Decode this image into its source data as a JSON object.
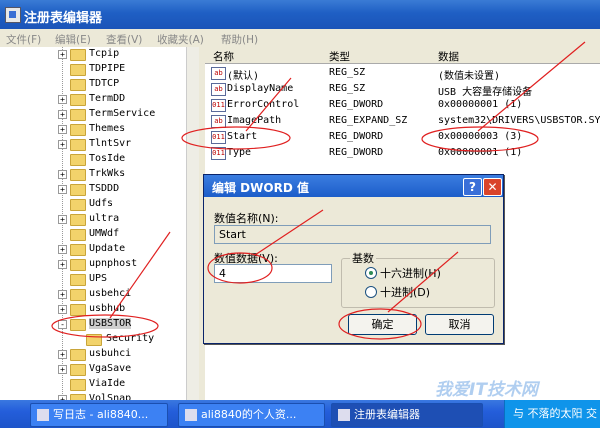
{
  "window": {
    "title": "注册表编辑器"
  },
  "menu": [
    "文件(F)",
    "编辑(E)",
    "查看(V)",
    "收藏夹(A)",
    "帮助(H)"
  ],
  "tree": {
    "items": [
      {
        "label": "Tcpip",
        "expander": "+"
      },
      {
        "label": "TDPIPE",
        "expander": ""
      },
      {
        "label": "TDTCP",
        "expander": ""
      },
      {
        "label": "TermDD",
        "expander": "+"
      },
      {
        "label": "TermService",
        "expander": "+"
      },
      {
        "label": "Themes",
        "expander": "+"
      },
      {
        "label": "TlntSvr",
        "expander": "+"
      },
      {
        "label": "TosIde",
        "expander": ""
      },
      {
        "label": "TrkWks",
        "expander": "+"
      },
      {
        "label": "TSDDD",
        "expander": "+"
      },
      {
        "label": "Udfs",
        "expander": ""
      },
      {
        "label": "ultra",
        "expander": "+"
      },
      {
        "label": "UMWdf",
        "expander": ""
      },
      {
        "label": "Update",
        "expander": "+"
      },
      {
        "label": "upnphost",
        "expander": "+"
      },
      {
        "label": "UPS",
        "expander": ""
      },
      {
        "label": "usbehci",
        "expander": "+"
      },
      {
        "label": "usbhub",
        "expander": "+"
      },
      {
        "label": "USBSTOR",
        "expander": "-"
      },
      {
        "label": "Security",
        "expander": ""
      },
      {
        "label": "usbuhci",
        "expander": "+"
      },
      {
        "label": "VgaSave",
        "expander": "+"
      },
      {
        "label": "ViaIde",
        "expander": ""
      },
      {
        "label": "VolSnap",
        "expander": "+"
      }
    ]
  },
  "list": {
    "headers": [
      "名称",
      "类型",
      "数据"
    ],
    "rows": [
      {
        "icon": "ab",
        "name": "(默认)",
        "type": "REG_SZ",
        "data": "(数值未设置)"
      },
      {
        "icon": "ab",
        "name": "DisplayName",
        "type": "REG_SZ",
        "data": "USB 大容量存储设备"
      },
      {
        "icon": "011",
        "name": "ErrorControl",
        "type": "REG_DWORD",
        "data": "0x00000001 (1)"
      },
      {
        "icon": "ab",
        "name": "ImagePath",
        "type": "REG_EXPAND_SZ",
        "data": "system32\\DRIVERS\\USBSTOR.SYS"
      },
      {
        "icon": "011",
        "name": "Start",
        "type": "REG_DWORD",
        "data": "0x00000003 (3)"
      },
      {
        "icon": "011",
        "name": "Type",
        "type": "REG_DWORD",
        "data": "0x00000001 (1)"
      }
    ]
  },
  "dialog": {
    "title": "编辑 DWORD 值",
    "help_label": "?",
    "close_label": "✕",
    "name_label": "数值名称(N):",
    "name_value": "Start",
    "data_label": "数值数据(V):",
    "data_value": "4",
    "base_legend": "基数",
    "hex_label": "十六进制(H)",
    "dec_label": "十进制(D)",
    "ok_label": "确定",
    "cancel_label": "取消"
  },
  "taskbar": {
    "items": [
      "写日志 - ali8840...",
      "ali8840的个人资...",
      "注册表编辑器"
    ],
    "tray_text": "与 不落的太阳 交"
  },
  "watermark": "我爱IT技术网",
  "annotation_color": "#e02020"
}
